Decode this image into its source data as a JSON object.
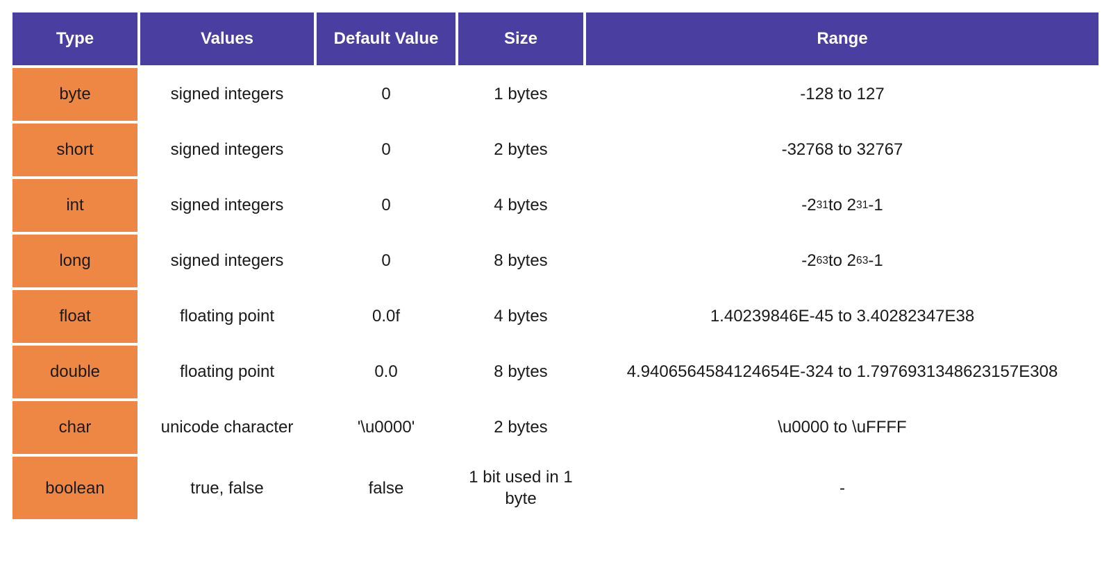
{
  "headers": {
    "type": "Type",
    "values": "Values",
    "default": "Default Value",
    "size": "Size",
    "range": "Range"
  },
  "rows": [
    {
      "type": "byte",
      "values": "signed integers",
      "default": "0",
      "size": "1 bytes",
      "range_html": "-128 to 127"
    },
    {
      "type": "short",
      "values": "signed integers",
      "default": "0",
      "size": "2 bytes",
      "range_html": "-32768 to 32767"
    },
    {
      "type": "int",
      "values": "signed integers",
      "default": "0",
      "size": "4 bytes",
      "range_html": "-2<sup>31</sup> to 2<sup>31</sup> -1"
    },
    {
      "type": "long",
      "values": "signed integers",
      "default": "0",
      "size": "8 bytes",
      "range_html": "-2<sup>63</sup> to 2<sup>63</sup> -1"
    },
    {
      "type": "float",
      "values": "floating point",
      "default": "0.0f",
      "size": "4 bytes",
      "range_html": "1.40239846E-45 to 3.40282347E38"
    },
    {
      "type": "double",
      "values": "floating point",
      "default": "0.0",
      "size": "8 bytes",
      "range_html": "4.9406564584124654E-324 to 1.7976931348623157E308"
    },
    {
      "type": "char",
      "values": "unicode character",
      "default": "'\\u0000'",
      "size": "2 bytes",
      "range_html": "\\u0000 to \\uFFFF"
    },
    {
      "type": "boolean",
      "values": "true, false",
      "default": "false",
      "size": "1 bit used in 1 byte",
      "range_html": "-"
    }
  ]
}
